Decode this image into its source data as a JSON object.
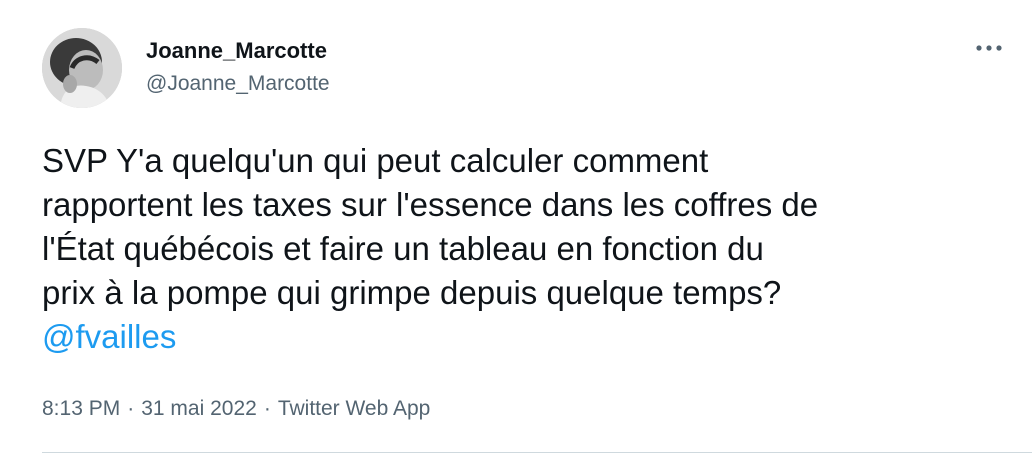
{
  "author": {
    "display_name": "Joanne_Marcotte",
    "handle": "@Joanne_Marcotte"
  },
  "icons": {
    "more": "more-horizontal-icon",
    "avatar": "profile-photo"
  },
  "tweet": {
    "lines": [
      "SVP Y'a quelqu'un qui peut calculer comment",
      "rapportent les taxes sur l'essence dans les coffres de",
      "l'État québécois et faire un tableau en fonction du",
      "prix à la pompe qui grimpe depuis quelque temps?"
    ],
    "mention": "@fvailles"
  },
  "meta": {
    "time": "8:13 PM",
    "separator": "·",
    "date": "31 mai 2022",
    "source": "Twitter Web App"
  },
  "colors": {
    "text": "#0f1419",
    "secondary": "#536471",
    "link": "#1d9bf0",
    "divider": "#cfd9de"
  }
}
